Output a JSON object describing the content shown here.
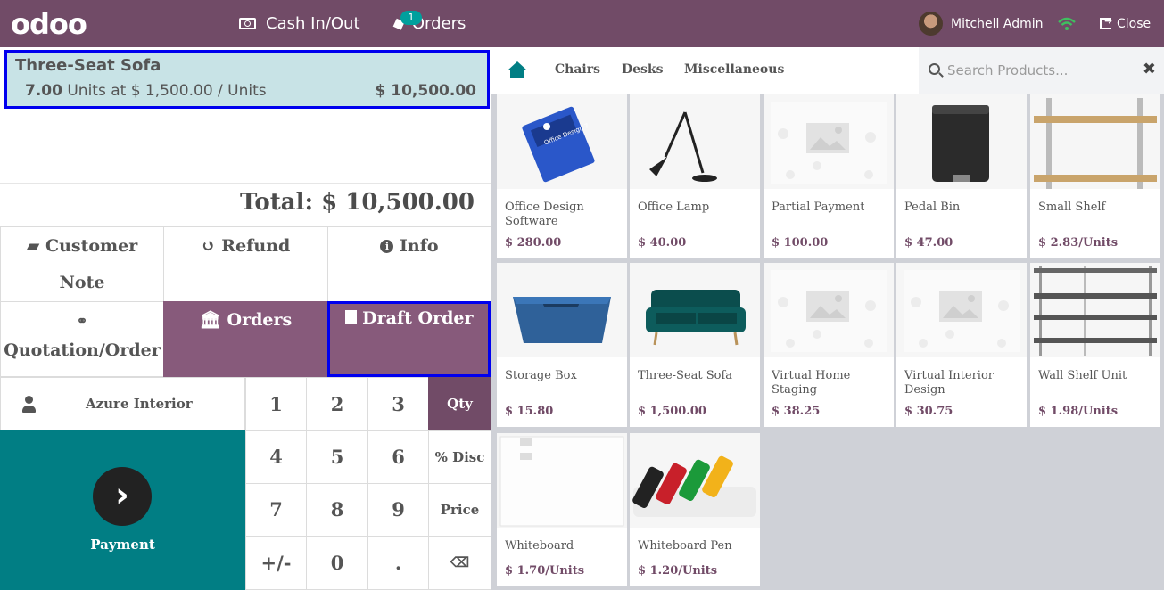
{
  "topbar": {
    "logo": "odoo",
    "cash_label": "Cash In/Out",
    "orders_label": "Orders",
    "orders_badge": "1",
    "user_name": "Mitchell Admin",
    "close_label": "Close"
  },
  "order": {
    "line": {
      "name": "Three-Seat Sofa",
      "qty": "7.00",
      "qty_text": " Units at $ 1,500.00 / Units",
      "price": "$ 10,500.00"
    },
    "total": "Total: $ 10,500.00"
  },
  "control_buttons": {
    "customer_note": [
      "Customer",
      "Note"
    ],
    "refund": "Refund",
    "info": "Info",
    "quotation": "Quotation/Order",
    "orders": "Orders",
    "draft_order": "Draft Order"
  },
  "customer": {
    "name": "Azure Interior"
  },
  "payment": {
    "label": "Payment",
    "icon": "chevron-right-icon"
  },
  "numpad": {
    "keys": [
      "1",
      "2",
      "3",
      "Qty",
      "4",
      "5",
      "6",
      "% Disc",
      "7",
      "8",
      "9",
      "Price",
      "+/-",
      "0",
      ".",
      "⌫"
    ],
    "active_mode": "Qty"
  },
  "categories": [
    "Chairs",
    "Desks",
    "Miscellaneous"
  ],
  "search": {
    "placeholder": "Search Products..."
  },
  "products": [
    {
      "name": "Office Design Software",
      "price": "$ 280.00",
      "image": "software-box"
    },
    {
      "name": "Office Lamp",
      "price": "$ 40.00",
      "image": "desk-lamp"
    },
    {
      "name": "Partial Payment",
      "price": "$ 100.00",
      "image": "placeholder"
    },
    {
      "name": "Pedal Bin",
      "price": "$ 47.00",
      "image": "pedal-bin"
    },
    {
      "name": "Small Shelf",
      "price": "$ 2.83/Units",
      "image": "shelf"
    },
    {
      "name": "Storage Box",
      "price": "$ 15.80",
      "image": "storage-box"
    },
    {
      "name": "Three-Seat Sofa",
      "price": "$ 1,500.00",
      "image": "sofa"
    },
    {
      "name": "Virtual Home Staging",
      "price": "$ 38.25",
      "image": "placeholder"
    },
    {
      "name": "Virtual Interior Design",
      "price": "$ 30.75",
      "image": "placeholder"
    },
    {
      "name": "Wall Shelf Unit",
      "price": "$ 1.98/Units",
      "image": "wall-shelf"
    },
    {
      "name": "Whiteboard",
      "price": "$ 1.70/Units",
      "image": "whiteboard"
    },
    {
      "name": "Whiteboard Pen",
      "price": "$ 1.20/Units",
      "image": "markers"
    }
  ],
  "colors": {
    "brand": "#714B67",
    "accent": "#017E84",
    "selected_line": "#C8E3E6",
    "highlight_border": "#0000EE"
  }
}
